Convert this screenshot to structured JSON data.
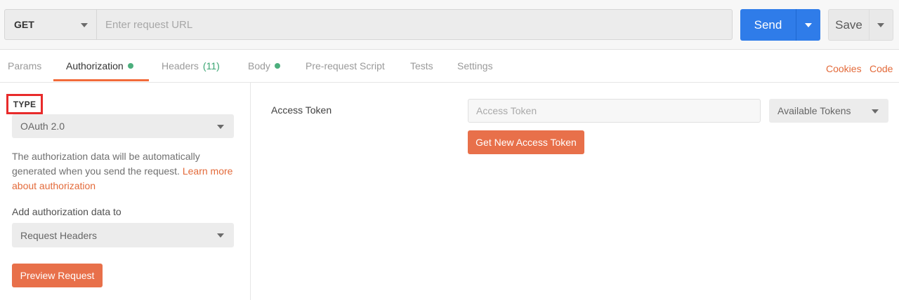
{
  "request": {
    "method": "GET",
    "url_value": "",
    "url_placeholder": "Enter request URL",
    "send_label": "Send",
    "save_label": "Save"
  },
  "tabs": [
    {
      "label": "Params"
    },
    {
      "label": "Authorization",
      "indicator": "green-dot"
    },
    {
      "label": "Headers",
      "count": "(11)"
    },
    {
      "label": "Body",
      "indicator": "green-dot"
    },
    {
      "label": "Pre-request Script"
    },
    {
      "label": "Tests"
    },
    {
      "label": "Settings"
    }
  ],
  "active_tab": "Authorization",
  "links": {
    "cookies": "Cookies",
    "code": "Code"
  },
  "auth": {
    "type_label": "TYPE",
    "type_value": "OAuth 2.0",
    "description": "The authorization data will be automatically generated when you send the request.",
    "learn_more": "Learn more about authorization",
    "add_to_label": "Add authorization data to",
    "add_to_value": "Request Headers",
    "preview_button": "Preview Request"
  },
  "token": {
    "label": "Access Token",
    "placeholder": "Access Token",
    "available_label": "Available Tokens",
    "get_new_button": "Get New Access Token"
  },
  "colors": {
    "accent_orange": "#e8704a",
    "send_blue": "#2f7ce9",
    "indicator_green": "#4caf7d",
    "highlight_red": "#e82b2b"
  }
}
